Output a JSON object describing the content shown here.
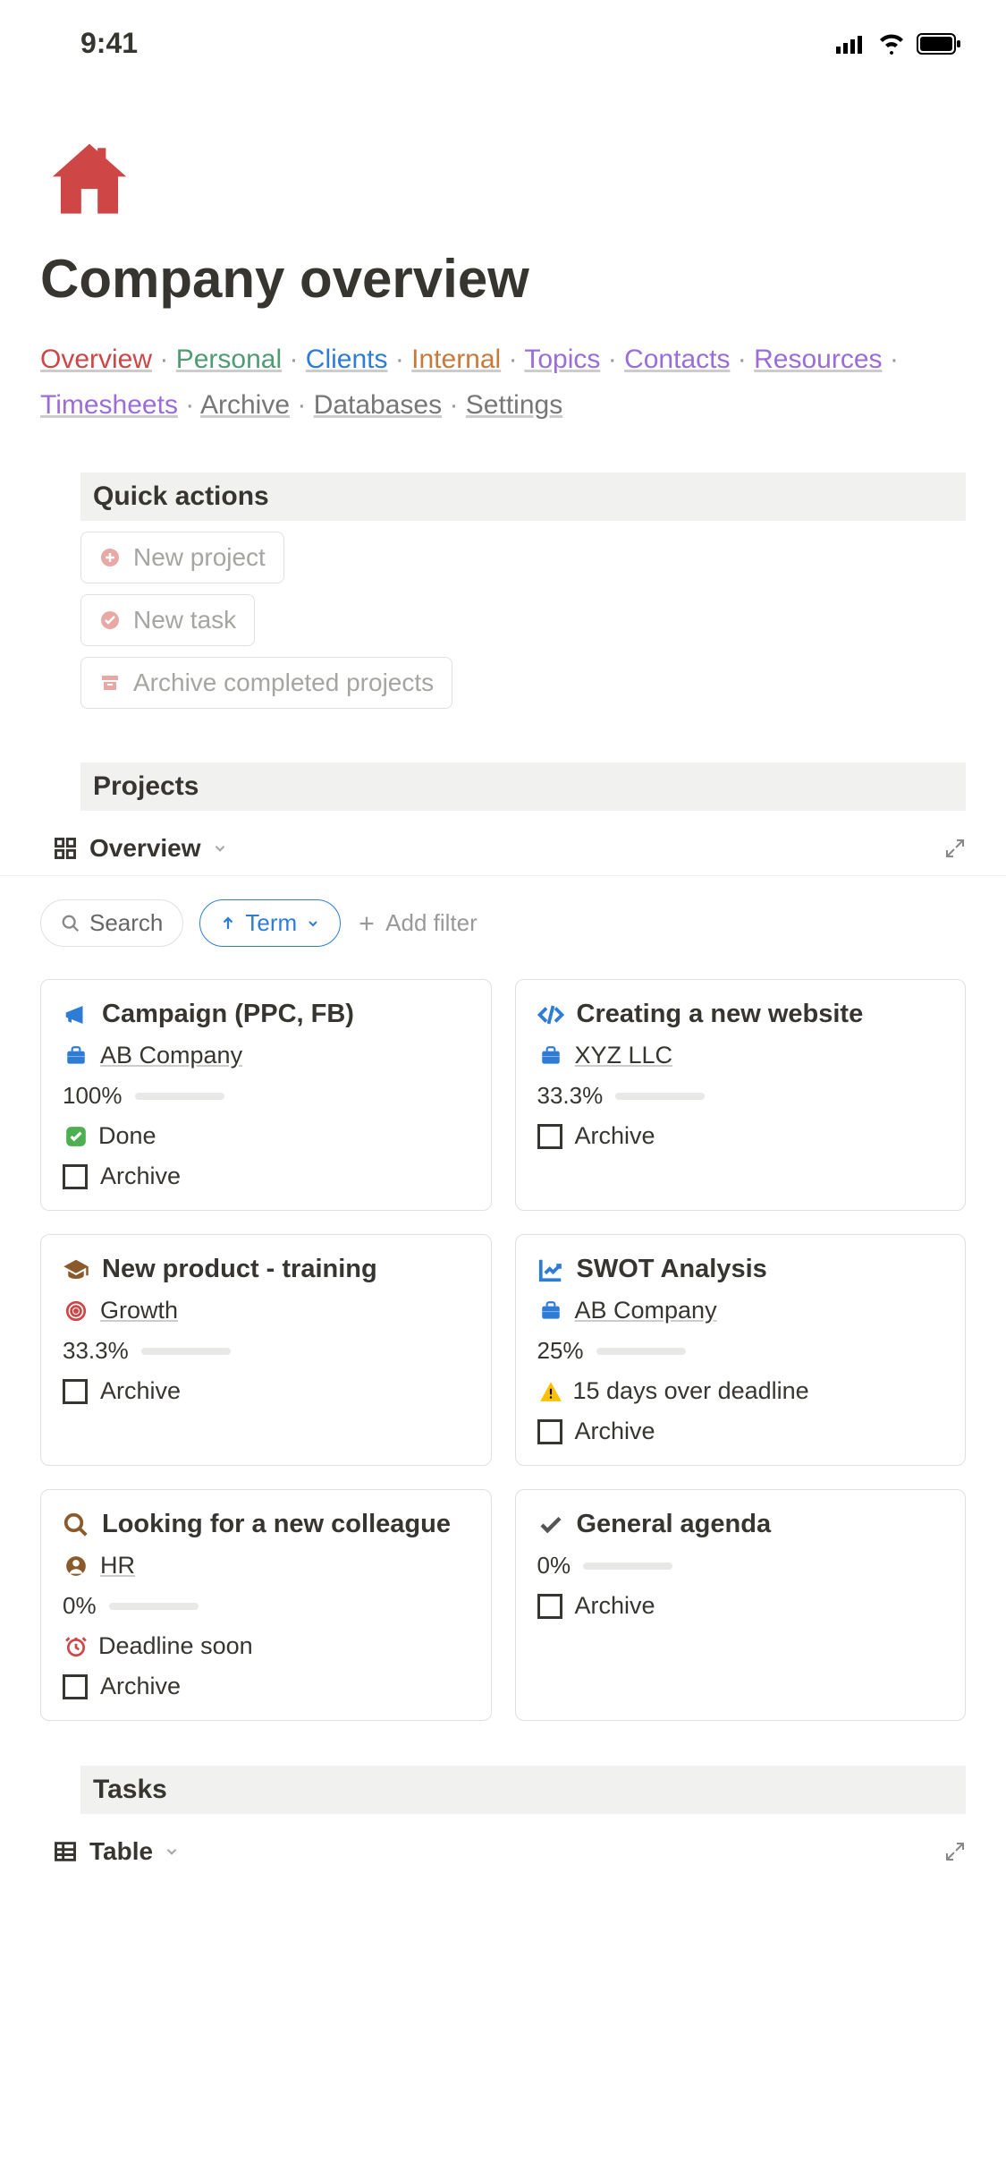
{
  "status_bar": {
    "time": "9:41"
  },
  "page": {
    "title": "Company overview",
    "icon_name": "house-icon"
  },
  "nav": [
    {
      "label": "Overview",
      "color": "#cf4647"
    },
    {
      "label": "Personal",
      "color": "#4f9b73"
    },
    {
      "label": "Clients",
      "color": "#2e7cd6"
    },
    {
      "label": "Internal",
      "color": "#c77a3b"
    },
    {
      "label": "Topics",
      "color": "#9b6dd7"
    },
    {
      "label": "Contacts",
      "color": "#9b6dd7"
    },
    {
      "label": "Resources",
      "color": "#9b6dd7"
    },
    {
      "label": "Timesheets",
      "color": "#9b6dd7"
    },
    {
      "label": "Archive",
      "color": "#777"
    },
    {
      "label": "Databases",
      "color": "#777"
    },
    {
      "label": "Settings",
      "color": "#777"
    }
  ],
  "quick_actions": {
    "header": "Quick actions",
    "buttons": [
      {
        "label": "New project",
        "icon": "plus-circle-icon"
      },
      {
        "label": "New task",
        "icon": "check-circle-icon"
      },
      {
        "label": "Archive completed projects",
        "icon": "archive-icon"
      }
    ]
  },
  "projects": {
    "header": "Projects",
    "view_label": "Overview",
    "search_label": "Search",
    "term_label": "Term",
    "add_filter_label": "Add filter",
    "archive_label": "Archive",
    "cards": [
      {
        "icon": "megaphone-icon",
        "icon_color": "#2e7cd6",
        "title": "Campaign (PPC, FB)",
        "sub_icon": "briefcase-icon",
        "sub_icon_color": "#2e7cd6",
        "sub_label": "AB Company",
        "progress_pct": "100%",
        "progress_fill": 100,
        "status_icon": "check-green-icon",
        "status_label": "Done",
        "archive": false
      },
      {
        "icon": "code-icon",
        "icon_color": "#2e7cd6",
        "title": "Creating a new website",
        "sub_icon": "briefcase-icon",
        "sub_icon_color": "#2e7cd6",
        "sub_label": "XYZ LLC",
        "progress_pct": "33.3%",
        "progress_fill": 33,
        "archive": false
      },
      {
        "icon": "graduation-icon",
        "icon_color": "#8b5a2b",
        "title": "New product - training",
        "sub_icon": "target-icon",
        "sub_icon_color": "#cf4647",
        "sub_label": "Growth",
        "progress_pct": "33.3%",
        "progress_fill": 33,
        "archive": false
      },
      {
        "icon": "chart-up-icon",
        "icon_color": "#2e7cd6",
        "title": "SWOT Analysis",
        "sub_icon": "briefcase-icon",
        "sub_icon_color": "#2e7cd6",
        "sub_label": "AB Company",
        "progress_pct": "25%",
        "progress_fill": 25,
        "status_icon": "warning-icon",
        "status_label": "15 days over deadline",
        "archive": false
      },
      {
        "icon": "search-brown-icon",
        "icon_color": "#8b5a2b",
        "title": "Looking for a new colleague",
        "sub_icon": "person-icon",
        "sub_icon_color": "#8b5a2b",
        "sub_label": "HR",
        "progress_pct": "0%",
        "progress_fill": 0,
        "status_icon": "alarm-icon",
        "status_label": "Deadline soon",
        "archive": false
      },
      {
        "icon": "check-gray-icon",
        "icon_color": "#555",
        "title": "General agenda",
        "progress_pct": "0%",
        "progress_fill": 0,
        "archive": false
      }
    ]
  },
  "tasks": {
    "header": "Tasks",
    "view_label": "Table"
  }
}
